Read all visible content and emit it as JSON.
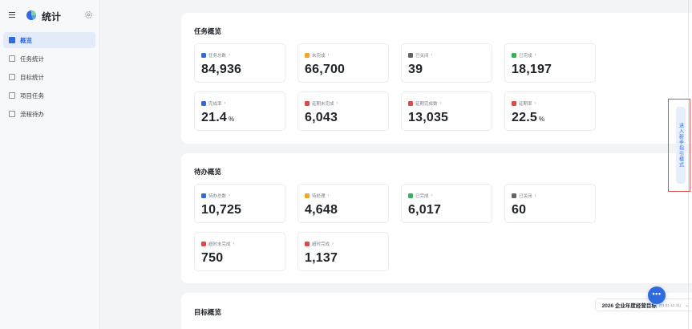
{
  "app": {
    "title": "统计"
  },
  "sidebar": {
    "items": [
      {
        "label": "概览",
        "active": true
      },
      {
        "label": "任务统计",
        "active": false
      },
      {
        "label": "目标统计",
        "active": false
      },
      {
        "label": "项目任务",
        "active": false
      },
      {
        "label": "流程待办",
        "active": false
      }
    ]
  },
  "task_overview": {
    "title": "任务概览",
    "cards": [
      {
        "label": "任务总数",
        "value": "84,936",
        "unit": "",
        "color": "#2f6bde"
      },
      {
        "label": "未完成",
        "value": "66,700",
        "unit": "",
        "color": "#f5a623"
      },
      {
        "label": "已关闭",
        "value": "39",
        "unit": "",
        "color": "#5f646b"
      },
      {
        "label": "已完成",
        "value": "18,197",
        "unit": "",
        "color": "#33b35a"
      },
      {
        "label": "完成率",
        "value": "21.4",
        "unit": "%",
        "color": "#2f6bde"
      },
      {
        "label": "延期未完成",
        "value": "6,043",
        "unit": "",
        "color": "#e5483f"
      },
      {
        "label": "延期完成数",
        "value": "13,035",
        "unit": "",
        "color": "#e5483f"
      },
      {
        "label": "延期率",
        "value": "22.5",
        "unit": "%",
        "color": "#e5483f"
      }
    ]
  },
  "todo_overview": {
    "title": "待办概览",
    "cards": [
      {
        "label": "待办总数",
        "value": "10,725",
        "unit": "",
        "color": "#2f6bde"
      },
      {
        "label": "待处理",
        "value": "4,648",
        "unit": "",
        "color": "#f5a623"
      },
      {
        "label": "已完成",
        "value": "6,017",
        "unit": "",
        "color": "#33b35a"
      },
      {
        "label": "已关闭",
        "value": "60",
        "unit": "",
        "color": "#5f646b"
      },
      {
        "label": "超时未完成",
        "value": "750",
        "unit": "",
        "color": "#e5483f"
      },
      {
        "label": "超时完成",
        "value": "1,137",
        "unit": "",
        "color": "#e5483f"
      }
    ]
  },
  "goal_overview": {
    "title": "目标概览",
    "dropdown": {
      "value": "2026 企业年度经营目标",
      "range": "(01.01-12.31)"
    }
  },
  "guide": {
    "label": "进入新手指引模式"
  },
  "fab": {
    "label": "•••"
  }
}
